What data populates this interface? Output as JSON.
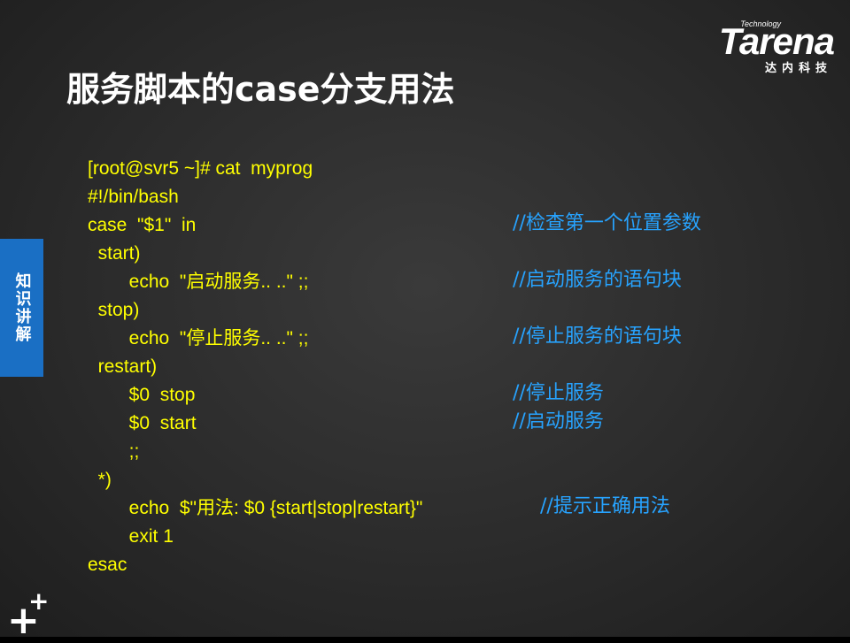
{
  "slide": {
    "title": "服务脚本的case分支用法",
    "side_tab": "知识讲解",
    "logo": {
      "tech": "Technology",
      "brand": "Tarena",
      "cn": "达内科技"
    },
    "code_lines": [
      "[root@svr5 ~]# cat  myprog",
      "#!/bin/bash",
      "case  \"$1\"  in",
      "  start)",
      "        echo  \"启动服务.. ..\" ;;",
      "  stop)",
      "        echo  \"停止服务.. ..\" ;;",
      "  restart)",
      "        $0  stop",
      "        $0  start",
      "        ;;",
      "  *)",
      "        echo  $\"用法: $0 {start|stop|restart}\"",
      "        exit 1",
      "esac"
    ],
    "comments": [
      "//检查第一个位置参数",
      "//启动服务的语句块",
      "//停止服务的语句块",
      "//停止服务",
      "//启动服务",
      "//提示正确用法"
    ],
    "colors": {
      "code": "#ffff00",
      "comment": "#27a3ff",
      "tab": "#1a6fc4",
      "title": "#ffffff"
    }
  }
}
